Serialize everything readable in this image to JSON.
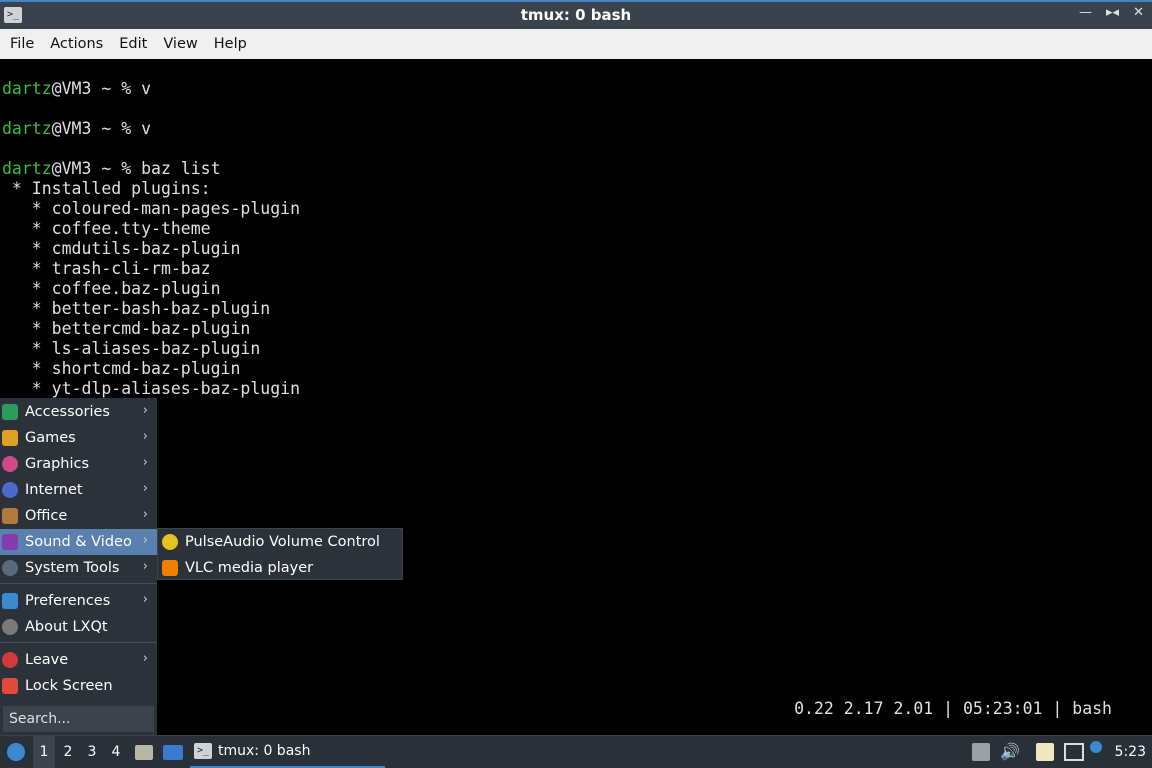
{
  "window": {
    "title": "tmux: 0 bash"
  },
  "menubar": {
    "items": [
      "File",
      "Actions",
      "Edit",
      "View",
      "Help"
    ]
  },
  "terminal": {
    "prompt_user": "dartz",
    "prompt_rest_1": "@VM3 ~ % v",
    "prompt_rest_2": "@VM3 ~ % v",
    "prompt_rest_3": "@VM3 ~ % baz list",
    "output": [
      " * Installed plugins:",
      "   * coloured-man-pages-plugin",
      "   * coffee.tty-theme",
      "   * cmdutils-baz-plugin",
      "   * trash-cli-rm-baz",
      "   * coffee.baz-plugin",
      "   * better-bash-baz-plugin",
      "   * bettercmd-baz-plugin",
      "   * ls-aliases-baz-plugin",
      "   * shortcmd-baz-plugin",
      "   * yt-dlp-aliases-baz-plugin"
    ],
    "status": "0.22 2.17 2.01 | 05:23:01 | bash"
  },
  "app_menu": {
    "items": [
      {
        "label": "Accessories",
        "icon": "accessories-icon",
        "color": "#2a9d5a"
      },
      {
        "label": "Games",
        "icon": "games-icon",
        "color": "#e0a020"
      },
      {
        "label": "Graphics",
        "icon": "graphics-icon",
        "color": "#d04a8a"
      },
      {
        "label": "Internet",
        "icon": "internet-icon",
        "color": "#4a6ad0"
      },
      {
        "label": "Office",
        "icon": "office-icon",
        "color": "#b07a3a"
      },
      {
        "label": "Sound & Video",
        "icon": "sound-video-icon",
        "color": "#8a3ab0"
      },
      {
        "label": "System Tools",
        "icon": "system-tools-icon",
        "color": "#5a6a7a"
      },
      {
        "label": "Preferences",
        "icon": "preferences-icon",
        "color": "#3a8ad0"
      },
      {
        "label": "About LXQt",
        "icon": "about-icon",
        "color": "#7a7a7a"
      },
      {
        "label": "Leave",
        "icon": "leave-icon",
        "color": "#d03a3a"
      },
      {
        "label": "Lock Screen",
        "icon": "lock-icon",
        "color": "#e04a3a"
      }
    ],
    "search_placeholder": "Search..."
  },
  "submenu": {
    "items": [
      {
        "label": "PulseAudio Volume Control",
        "icon": "pulseaudio-icon",
        "color": "#e8c020"
      },
      {
        "label": "VLC media player",
        "icon": "vlc-icon",
        "color": "#f08000"
      }
    ]
  },
  "taskbar": {
    "workspaces": [
      "1",
      "2",
      "3",
      "4"
    ],
    "active_workspace": "1",
    "task_label": "tmux: 0 bash",
    "clock": "5:23"
  }
}
